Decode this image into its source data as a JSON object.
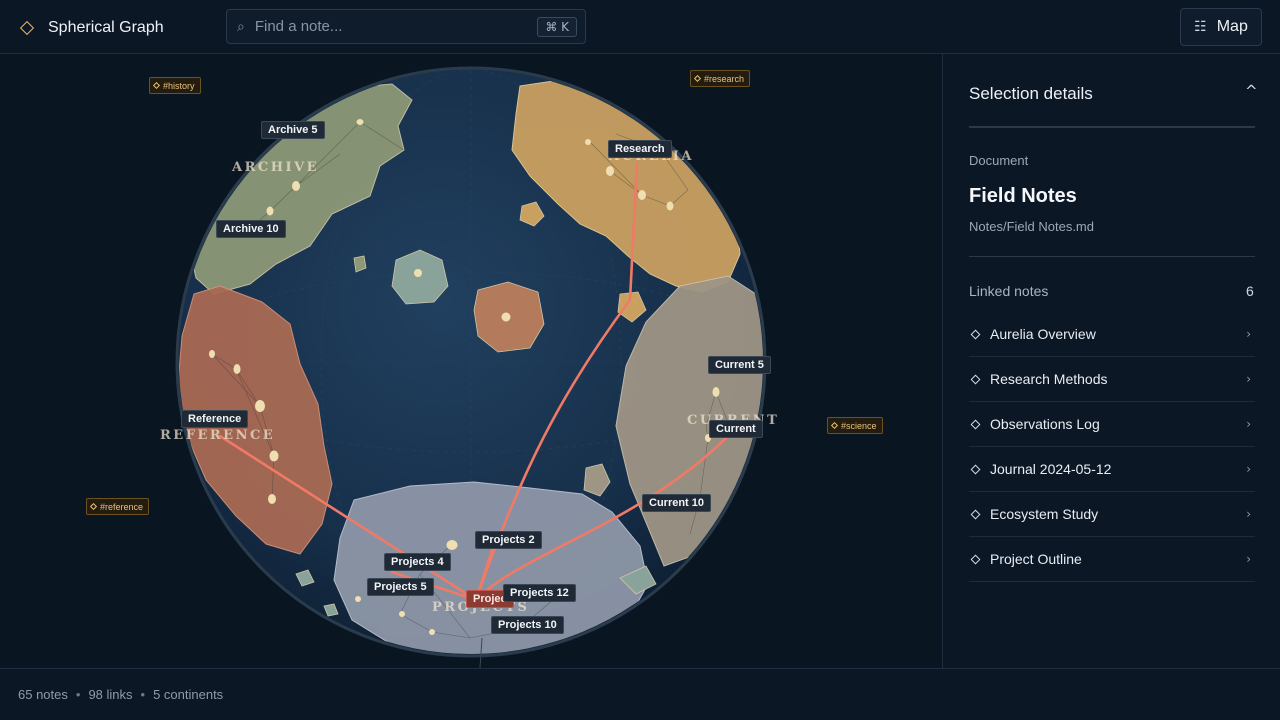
{
  "app": {
    "title": "Spherical Graph",
    "brand_icon": "diamond-icon"
  },
  "search": {
    "placeholder": "Find a note...",
    "value": "",
    "shortcut": "⌘ K"
  },
  "view_button": {
    "label": "Map",
    "icon": "list-icon"
  },
  "globe": {
    "tags": [
      {
        "id": "history",
        "label": "#history"
      },
      {
        "id": "research",
        "label": "#research"
      },
      {
        "id": "science",
        "label": "#science"
      },
      {
        "id": "reference",
        "label": "#reference"
      }
    ],
    "continents": [
      {
        "id": "archive",
        "label": "ARCHIVE",
        "color": "#8d9877"
      },
      {
        "id": "aurelia",
        "label": "AURELIA",
        "color": "#c9a060"
      },
      {
        "id": "current",
        "label": "CURRENT",
        "color": "#9f9585"
      },
      {
        "id": "reference",
        "label": "REFERENCE",
        "color": "#a86a54"
      },
      {
        "id": "projects",
        "label": "PROJECTS",
        "color": "#8e97a8"
      }
    ],
    "nodes": [
      {
        "id": "archive5",
        "label": "Archive 5"
      },
      {
        "id": "archive10",
        "label": "Archive 10"
      },
      {
        "id": "research",
        "label": "Research"
      },
      {
        "id": "current5",
        "label": "Current 5"
      },
      {
        "id": "current",
        "label": "Current"
      },
      {
        "id": "current10",
        "label": "Current 10"
      },
      {
        "id": "reference",
        "label": "Reference"
      },
      {
        "id": "projects2",
        "label": "Projects 2"
      },
      {
        "id": "projects4",
        "label": "Projects 4"
      },
      {
        "id": "projects5",
        "label": "Projects 5"
      },
      {
        "id": "projects12",
        "label": "Projects 12"
      },
      {
        "id": "projects10",
        "label": "Projects 10"
      },
      {
        "id": "selected",
        "label": "Projec"
      }
    ],
    "ocean_color": "#1b3452",
    "link_color": "#f07a66"
  },
  "panel": {
    "title": "Selection details",
    "collapse_icon": "^",
    "doc_kind": "Document",
    "doc_title": "Field Notes",
    "doc_path": "Notes/Field Notes.md",
    "linked_label": "Linked notes",
    "linked_count": "6",
    "linked_notes": [
      {
        "label": "Aurelia Overview"
      },
      {
        "label": "Research Methods"
      },
      {
        "label": "Observations Log"
      },
      {
        "label": "Journal 2024-05-12"
      },
      {
        "label": "Ecosystem Study"
      },
      {
        "label": "Project Outline"
      }
    ],
    "chevron": "›"
  },
  "footer": {
    "notes": "65 notes",
    "links": "98 links",
    "continents": "5 continents",
    "separator": "•"
  }
}
